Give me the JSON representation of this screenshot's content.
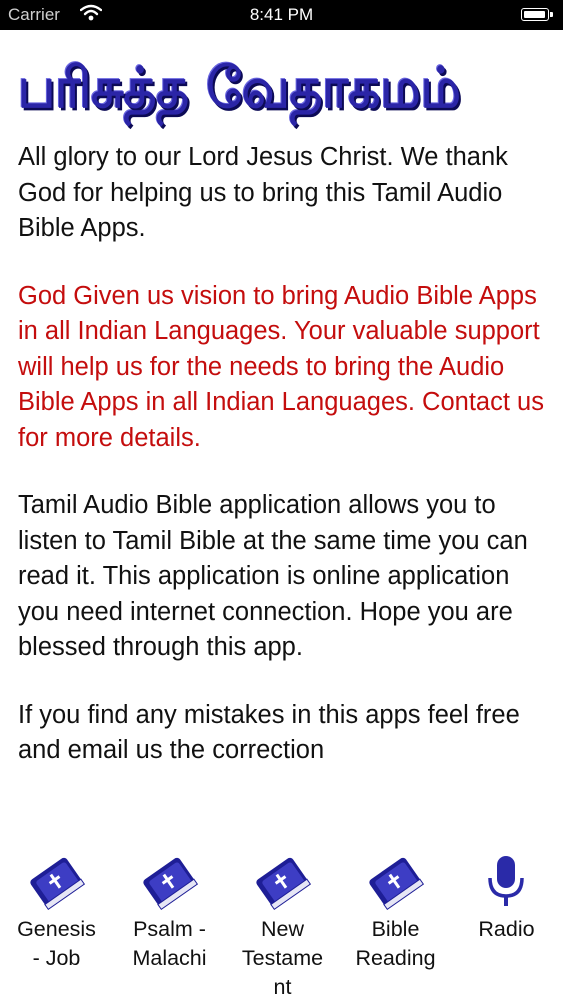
{
  "status_bar": {
    "carrier": "Carrier",
    "time": "8:41 PM"
  },
  "app_title": "பரிசுத்த வேதாகமம்",
  "content": {
    "paragraphs": [
      {
        "text": "All glory to our Lord Jesus Christ. We thank God for helping us to bring this Tamil Audio Bible Apps.",
        "color": "#111111"
      },
      {
        "text": "God Given us vision to bring Audio Bible Apps in all Indian Languages. Your valuable support will help us for the needs to bring the Audio Bible Apps in all Indian Languages. Contact us for more details.",
        "color": "#c40d0d"
      },
      {
        "text": "Tamil Audio Bible application allows you to listen to Tamil Bible at the same time you can read it. This application is online application you need internet connection. Hope you are blessed through this app.",
        "color": "#111111"
      },
      {
        "text": "If you find any mistakes in this apps feel free and email us the correction",
        "color": "#111111"
      }
    ]
  },
  "tab_bar": {
    "tabs": [
      {
        "icon": "bible-book-icon",
        "label_lines": [
          "Genesis",
          "- Job"
        ]
      },
      {
        "icon": "bible-book-icon",
        "label_lines": [
          "Psalm -",
          "Malachi"
        ]
      },
      {
        "icon": "bible-book-icon",
        "label_lines": [
          "New",
          "Testame",
          "nt"
        ]
      },
      {
        "icon": "bible-book-icon",
        "label_lines": [
          "Bible",
          "Reading"
        ]
      },
      {
        "icon": "microphone-icon",
        "label_lines": [
          "Radio"
        ]
      }
    ]
  },
  "colors": {
    "title": "#2b25a7",
    "accent_red": "#c40d0d",
    "tab_icon": "#2a2aa8"
  }
}
